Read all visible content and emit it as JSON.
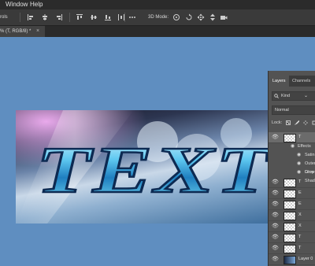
{
  "menubar": {
    "items": [
      "Window",
      "Help"
    ]
  },
  "optionsbar": {
    "left_label": "rols",
    "mode_label": "3D Mode:"
  },
  "document_tab": {
    "title": "% (T, RGB/8) *"
  },
  "artwork": {
    "text": "TEXT"
  },
  "layers_panel": {
    "tabs": [
      "Layers",
      "Channels"
    ],
    "kind_label": "Kind",
    "blend_mode": "Normal",
    "lock_label": "Lock:",
    "layers": [
      {
        "name": "T",
        "selected": true
      },
      {
        "name": "T"
      },
      {
        "name": "E"
      },
      {
        "name": "E"
      },
      {
        "name": "X"
      },
      {
        "name": "X"
      },
      {
        "name": "T"
      },
      {
        "name": "T"
      },
      {
        "name": "Layer 0"
      }
    ],
    "effects_label": "Effects",
    "effects": [
      "Satin",
      "Outer Glow",
      "Drop Shadow"
    ]
  }
}
